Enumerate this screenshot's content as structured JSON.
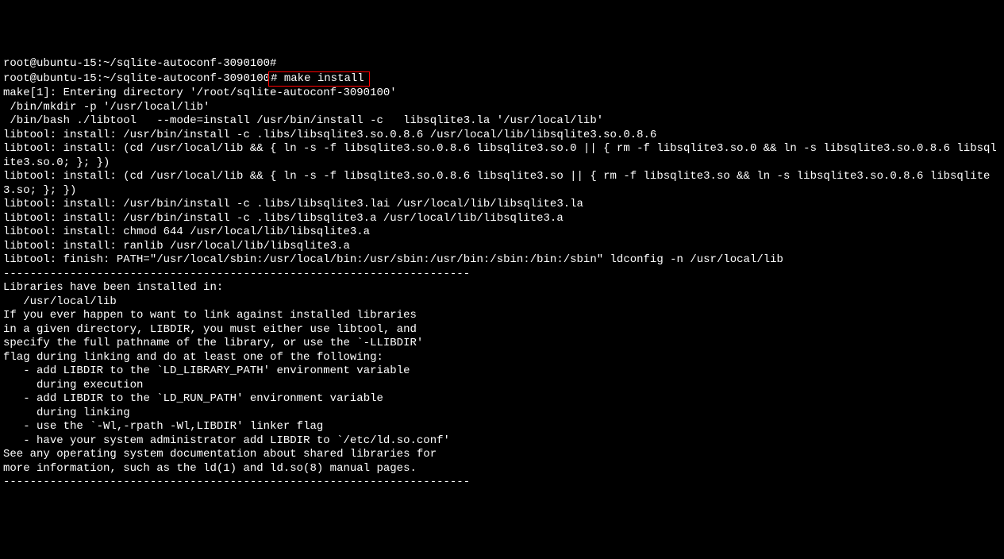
{
  "terminal": {
    "prompt1": "root@ubuntu-15:~/sqlite-autoconf-3090100#",
    "prompt2": "root@ubuntu-15:~/sqlite-autoconf-3090100",
    "command": "# make install",
    "lines": [
      "make[1]: Entering directory '/root/sqlite-autoconf-3090100'",
      " /bin/mkdir -p '/usr/local/lib'",
      " /bin/bash ./libtool   --mode=install /usr/bin/install -c   libsqlite3.la '/usr/local/lib'",
      "libtool: install: /usr/bin/install -c .libs/libsqlite3.so.0.8.6 /usr/local/lib/libsqlite3.so.0.8.6",
      "libtool: install: (cd /usr/local/lib && { ln -s -f libsqlite3.so.0.8.6 libsqlite3.so.0 || { rm -f libsqlite3.so.0 && ln -s libsqlite3.so.0.8.6 libsqlite3.so.0; }; })",
      "libtool: install: (cd /usr/local/lib && { ln -s -f libsqlite3.so.0.8.6 libsqlite3.so || { rm -f libsqlite3.so && ln -s libsqlite3.so.0.8.6 libsqlite3.so; }; })",
      "libtool: install: /usr/bin/install -c .libs/libsqlite3.lai /usr/local/lib/libsqlite3.la",
      "libtool: install: /usr/bin/install -c .libs/libsqlite3.a /usr/local/lib/libsqlite3.a",
      "libtool: install: chmod 644 /usr/local/lib/libsqlite3.a",
      "libtool: install: ranlib /usr/local/lib/libsqlite3.a",
      "libtool: finish: PATH=\"/usr/local/sbin:/usr/local/bin:/usr/sbin:/usr/bin:/sbin:/bin:/sbin\" ldconfig -n /usr/local/lib",
      "----------------------------------------------------------------------",
      "Libraries have been installed in:",
      "   /usr/local/lib",
      "",
      "If you ever happen to want to link against installed libraries",
      "in a given directory, LIBDIR, you must either use libtool, and",
      "specify the full pathname of the library, or use the `-LLIBDIR'",
      "flag during linking and do at least one of the following:",
      "   - add LIBDIR to the `LD_LIBRARY_PATH' environment variable",
      "     during execution",
      "   - add LIBDIR to the `LD_RUN_PATH' environment variable",
      "     during linking",
      "   - use the `-Wl,-rpath -Wl,LIBDIR' linker flag",
      "   - have your system administrator add LIBDIR to `/etc/ld.so.conf'",
      "",
      "See any operating system documentation about shared libraries for",
      "more information, such as the ld(1) and ld.so(8) manual pages.",
      "----------------------------------------------------------------------"
    ]
  },
  "highlight": {
    "color": "#ff0000"
  }
}
